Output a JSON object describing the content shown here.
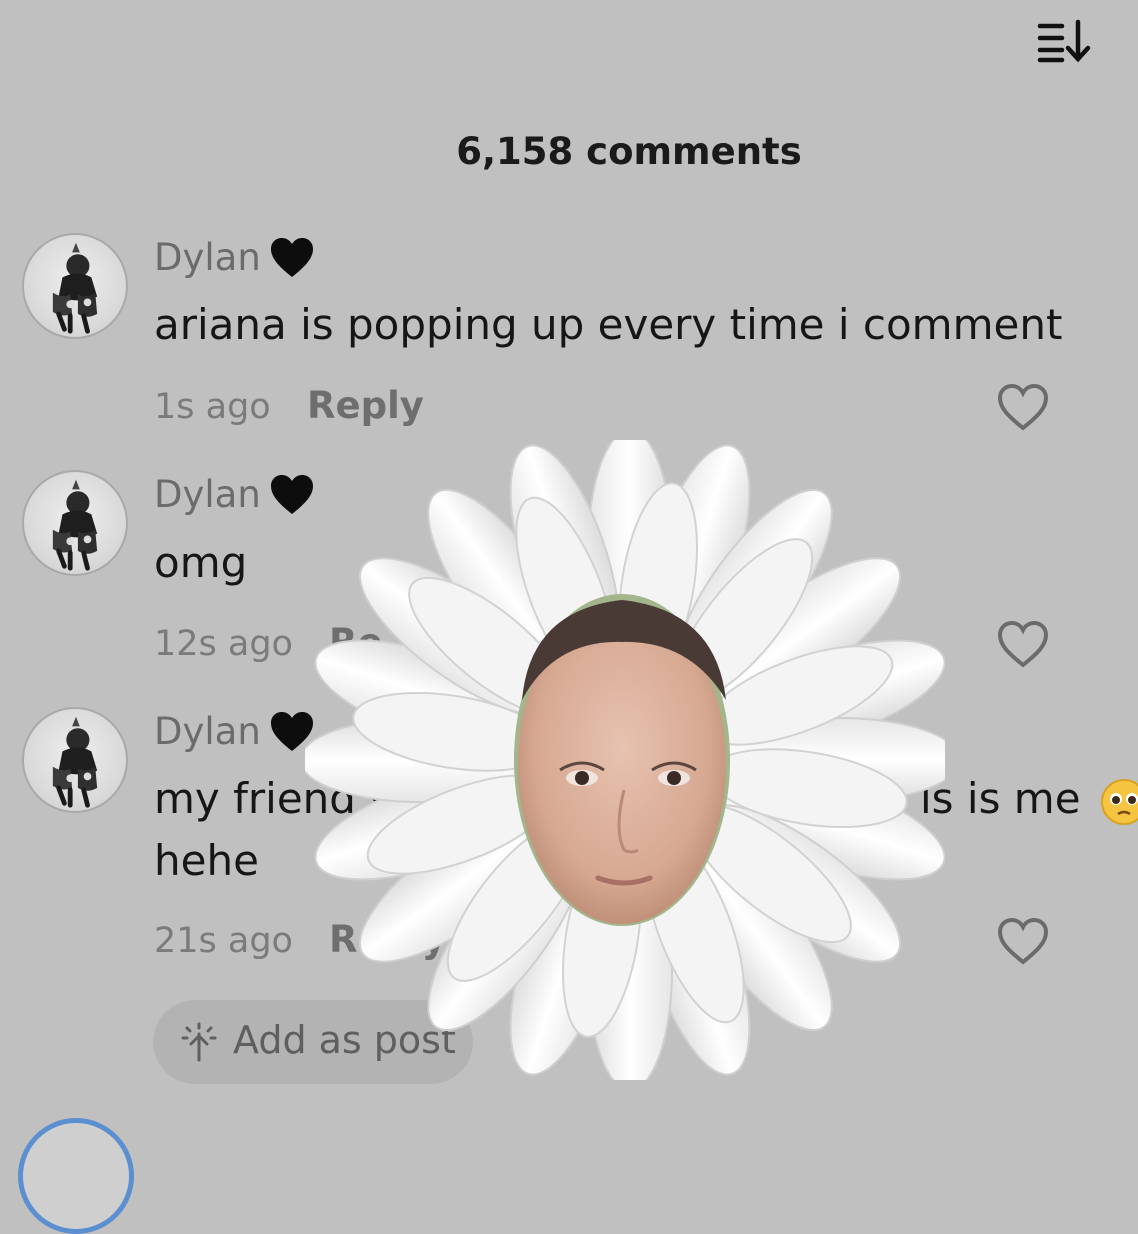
{
  "header": {
    "title": "6,158 comments",
    "sort_icon": "sort-descending-icon"
  },
  "comments": [
    {
      "username": "Dylan",
      "username_emoji": "black-heart",
      "text": "ariana is popping up every time i comment",
      "time": "1s ago",
      "reply_label": "Reply",
      "like_icon": "heart-outline-icon"
    },
    {
      "username": "Dylan",
      "username_emoji": "black-heart",
      "text": "omg",
      "time": "12s ago",
      "reply_label": "Re",
      "like_icon": "heart-outline-icon"
    },
    {
      "username": "Dylan",
      "username_emoji": "black-heart",
      "text_line1_start": "my friend se",
      "text_line1_end": "is is me",
      "text_line2": "hehe",
      "trailing_emoji": "pleading-face",
      "time": "21s ago",
      "reply_label": "Reply",
      "like_icon": "heart-outline-icon"
    }
  ],
  "add_post": {
    "label": "Add as post",
    "icon": "sparkle-arrow-icon"
  },
  "sticker": {
    "description_icon": "daisy-face-sticker"
  },
  "colors": {
    "background": "#c0c0c0",
    "text_primary": "#161616",
    "text_secondary": "#6b6b6b",
    "pill_bg": "#b3b3b3",
    "story_ring": "#5b8fd0"
  }
}
